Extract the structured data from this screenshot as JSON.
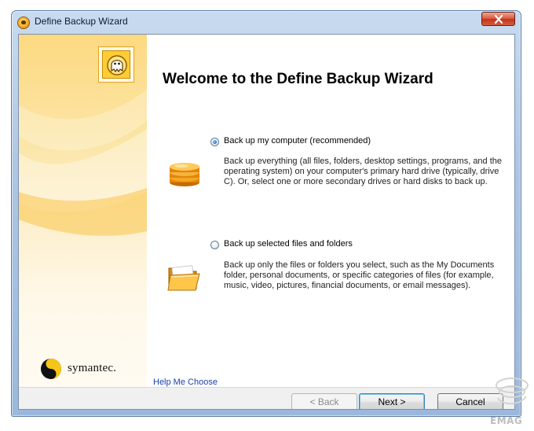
{
  "window": {
    "title": "Define Backup Wizard",
    "icon": "norton-ghost-icon"
  },
  "sidebar": {
    "brand": "symantec."
  },
  "main": {
    "title": "Welcome to the Define Backup Wizard",
    "options": [
      {
        "label": "Back up my computer (recommended)",
        "description": "Back up everything (all files, folders, desktop settings, programs, and the operating system) on your computer's primary hard drive (typically, drive C). Or, select one or more secondary drives or hard disks to back up.",
        "selected": true,
        "icon": "drive-stack-icon"
      },
      {
        "label": "Back up selected files and folders",
        "description": "Back up only the files or folders you select, such as the My Documents folder, personal documents, or specific categories of files (for example, music, video, pictures, financial documents, or email messages).",
        "selected": false,
        "icon": "folder-icon"
      }
    ],
    "help_link": "Help Me Choose"
  },
  "footer": {
    "back_label": "< Back",
    "next_label": "Next >",
    "cancel_label": "Cancel"
  },
  "watermark": "EMAG",
  "colors": {
    "accent_orange": "#f5a623",
    "link_blue": "#1a3fb0",
    "titlebar_blue": "#aec6e3",
    "close_red": "#c0341c"
  }
}
